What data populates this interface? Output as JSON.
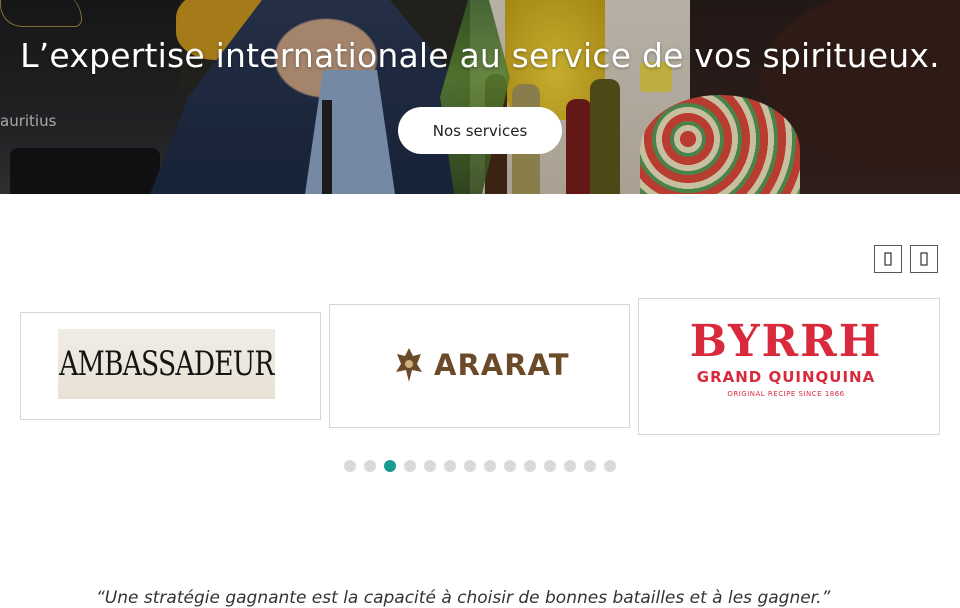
{
  "hero": {
    "title": "L’expertise internationale au service de vos spiritueux.",
    "cta_label": "Nos services",
    "sign_text": "auritius"
  },
  "carousel": {
    "prev_icon": "chevron-left-icon",
    "next_icon": "chevron-right-icon",
    "slides": [
      {
        "logo_text": "AMBASSADEUR"
      },
      {
        "logo_text": "ARARAT"
      },
      {
        "logo_text": "BYRRH",
        "subtitle": "GRAND QUINQUINA",
        "tagline": "ORIGINAL RECIPE SINCE 1866"
      }
    ],
    "dot_count": 14,
    "active_dot": 3,
    "accent_color": "#1a9b8f",
    "brand_red": "#d82a3c"
  },
  "quote": {
    "text": "“Une stratégie gagnante est la capacité à choisir de bonnes batailles et à les gagner.”"
  }
}
